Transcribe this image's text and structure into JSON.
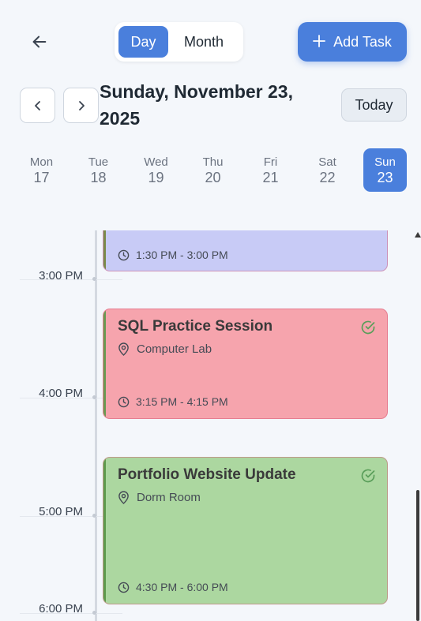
{
  "header": {
    "view_toggle": {
      "day_label": "Day",
      "month_label": "Month",
      "selected": "Day"
    },
    "add_task_label": "Add Task"
  },
  "date_nav": {
    "title": "Sunday, November 23, 2025",
    "today_label": "Today"
  },
  "week": [
    {
      "weekday": "Mon",
      "day": "17",
      "active": false
    },
    {
      "weekday": "Tue",
      "day": "18",
      "active": false
    },
    {
      "weekday": "Wed",
      "day": "19",
      "active": false
    },
    {
      "weekday": "Thu",
      "day": "20",
      "active": false
    },
    {
      "weekday": "Fri",
      "day": "21",
      "active": false
    },
    {
      "weekday": "Sat",
      "day": "22",
      "active": false
    },
    {
      "weekday": "Sun",
      "day": "23",
      "active": true
    }
  ],
  "timeline": {
    "hours": [
      "3:00 PM",
      "4:00 PM",
      "5:00 PM",
      "6:00 PM"
    ],
    "events": [
      {
        "title": "",
        "location": "",
        "time": "1:30 PM - 3:00 PM",
        "color": "#c8cbf6",
        "completed": false
      },
      {
        "title": "SQL Practice Session",
        "location": "Computer Lab",
        "time": "3:15 PM - 4:15 PM",
        "color": "#f6a4ad",
        "completed": true
      },
      {
        "title": "Portfolio Website Update",
        "location": "Dorm Room",
        "time": "4:30 PM - 6:00 PM",
        "color": "#acd7a0",
        "completed": true
      }
    ]
  },
  "colors": {
    "accent": "#4a7fdc",
    "background": "#f4f7fb",
    "check": "#5a9e5a"
  },
  "icons": [
    "arrow-left-icon",
    "plus-icon",
    "chevron-left-icon",
    "chevron-right-icon",
    "clock-icon",
    "location-pin-icon",
    "check-circle-icon"
  ]
}
